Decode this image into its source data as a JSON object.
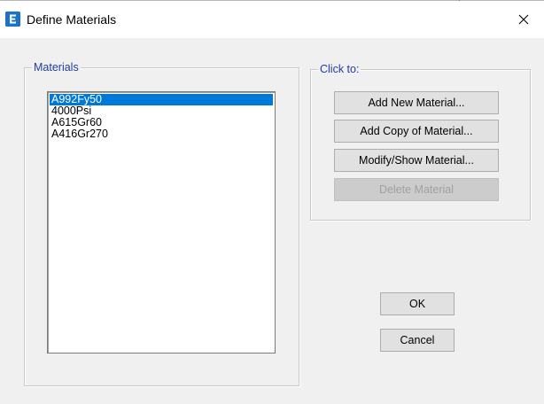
{
  "window": {
    "title": "Define Materials",
    "app_icon": "etabs-e-icon",
    "close_icon": "close-icon"
  },
  "materials_group": {
    "label": "Materials",
    "items": [
      "A992Fy50",
      "4000Psi",
      "A615Gr60",
      "A416Gr270"
    ],
    "selected_index": 0
  },
  "click_to_group": {
    "label": "Click to:",
    "add_new_label": "Add New Material...",
    "add_copy_label": "Add Copy of Material...",
    "modify_show_label": "Modify/Show Material...",
    "delete_label": "Delete Material"
  },
  "actions": {
    "ok_label": "OK",
    "cancel_label": "Cancel"
  },
  "colors": {
    "selection": "#0078d7",
    "group_label": "#1f3f9f",
    "app_icon": "#1a73c7"
  }
}
